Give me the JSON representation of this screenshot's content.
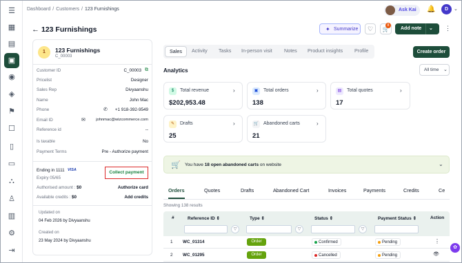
{
  "breadcrumb": {
    "items": [
      "Dashboard",
      "Customers"
    ],
    "current": "123 Furnishings"
  },
  "user": {
    "name": "Ask Kai",
    "initial": "D"
  },
  "header": {
    "title": "123 Furnishings",
    "summarize": "Summarize",
    "add_note": "Add note",
    "cart_count": "8"
  },
  "customer": {
    "initial": "1",
    "name": "123 Furnishings",
    "code": "C_00003",
    "fields": [
      {
        "k": "Customer ID",
        "v": "C_00003"
      },
      {
        "k": "Pricelist",
        "v": "Designer"
      },
      {
        "k": "Sales Rep",
        "v": "Divyaanshu"
      },
      {
        "k": "Name",
        "v": "John Mac"
      },
      {
        "k": "Phone",
        "v": "+1 918-392-9549"
      },
      {
        "k": "Email ID",
        "v": "johnmac@wizcommerce.com"
      },
      {
        "k": "Reference id",
        "v": "--"
      },
      {
        "k": "Is taxable",
        "v": "No"
      },
      {
        "k": "Payment Terms",
        "v": "Pre - Authorize payment"
      }
    ],
    "card": {
      "ending": "Ending in 1111",
      "brand": "VISA",
      "expiry": "Expiry 05/65",
      "collect": "Collect payment"
    },
    "authorised": {
      "label": "Authorised amount :",
      "value": "$0",
      "action": "Authorize card"
    },
    "credits": {
      "label": "Available credits :",
      "value": "$0",
      "action": "Add credits"
    },
    "updated": {
      "label": "Updated on",
      "value": "04 Feb 2026 by Divyaanshu"
    },
    "created": {
      "label": "Created on",
      "value": "23 May 2024 by Divyaanshu"
    }
  },
  "tabs": [
    "Sales",
    "Activity",
    "Tasks",
    "In-person visit",
    "Notes",
    "Product insights",
    "Profile"
  ],
  "create_order": "Create order",
  "analytics": {
    "title": "Analytics",
    "range": "All time",
    "stats": [
      {
        "label": "Total revenue",
        "value": "$202,953.48",
        "icon": "$",
        "color": "#d1fae5"
      },
      {
        "label": "Total orders",
        "value": "138",
        "icon": "▣",
        "color": "#dbeafe"
      },
      {
        "label": "Total quotes",
        "value": "17",
        "icon": "▤",
        "color": "#ede9fe"
      },
      {
        "label": "Drafts",
        "value": "25",
        "icon": "✎",
        "color": "#fef3c7"
      },
      {
        "label": "Abandoned carts",
        "value": "21",
        "icon": "🛒",
        "color": "#f3f4f6"
      }
    ]
  },
  "abandoned_banner": {
    "prefix": "You have",
    "bold": "18 open abandoned carts",
    "suffix": "on website"
  },
  "order_tabs": [
    "Orders",
    "Quotes",
    "Drafts",
    "Abandoned Cart",
    "Invoices",
    "Payments",
    "Credits",
    "Ce"
  ],
  "showing": "Showing 138 results",
  "table": {
    "headers": [
      "#",
      "Reference ID",
      "Type",
      "Status",
      "Payment Status",
      "Action"
    ],
    "rows": [
      {
        "n": "1",
        "ref": "WC_01314",
        "type": "Order",
        "status": "Confirmed",
        "status_color": "#16a34a",
        "payment": "Pending",
        "action": "⋮"
      },
      {
        "n": "2",
        "ref": "WC_01295",
        "type": "Order",
        "status": "Cancelled",
        "status_color": "#dc2626",
        "payment": "Pending",
        "action": "👁"
      }
    ]
  }
}
